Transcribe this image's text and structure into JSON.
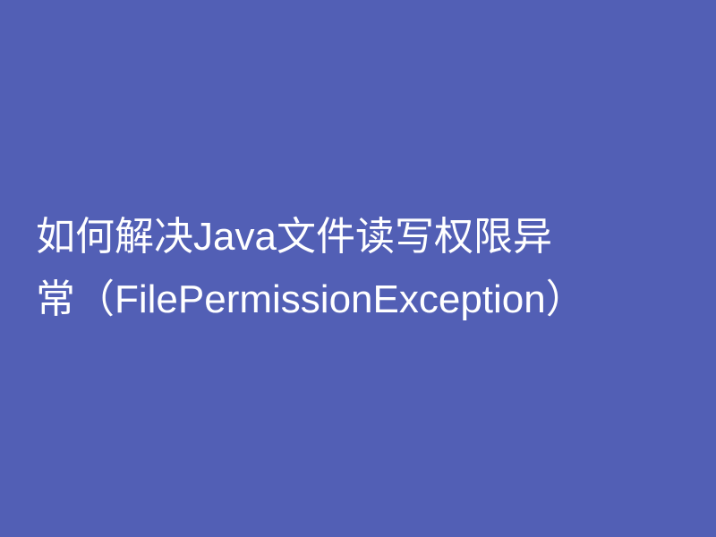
{
  "heading": {
    "text": "如何解决Java文件读写权限异常（FilePermissionException）"
  }
}
